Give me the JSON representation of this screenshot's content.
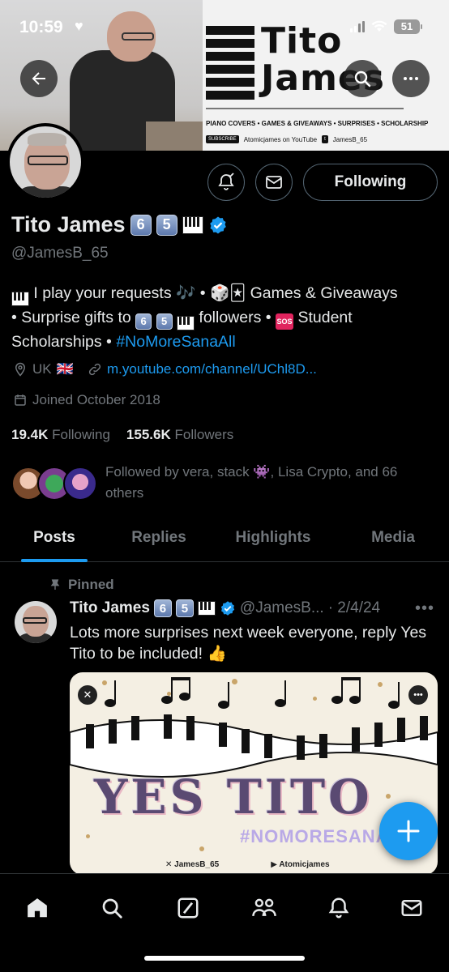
{
  "status_bar": {
    "time": "10:59",
    "battery": "51"
  },
  "banner": {
    "logo_line1": "Tito",
    "logo_line2": "James",
    "tagline": "PIANO COVERS • GAMES & GIVEAWAYS • SURPRISES • SCHOLARSHIP",
    "subscribe_badge": "SUBSCRIBE",
    "youtube_text": "Atomicjames on YouTube",
    "twitter_text": "JamesB_65"
  },
  "profile": {
    "display_name": "Tito James",
    "badge_digits": [
      "6",
      "5"
    ],
    "handle": "@JamesB_65",
    "bio_part1": "I play your requests",
    "bio_part2": "Games & Giveaways",
    "bio_part3": "• Surprise gifts to",
    "bio_part4": "followers •",
    "bio_part5": "Student Scholarships •",
    "bio_hashtag": "#NoMoreSanaAll",
    "sos_label": "SOS",
    "location": "UK",
    "location_flag": "🇬🇧",
    "website": "m.youtube.com/channel/UChl8D...",
    "joined": "Joined October 2018",
    "following_count": "19.4K",
    "following_label": "Following",
    "followers_count": "155.6K",
    "followers_label": "Followers",
    "followed_by": "Followed by vera, stack 👾, Lisa Crypto, and 66 others"
  },
  "actions": {
    "following_button": "Following"
  },
  "tabs": [
    {
      "label": "Posts",
      "active": true
    },
    {
      "label": "Replies",
      "active": false
    },
    {
      "label": "Highlights",
      "active": false
    },
    {
      "label": "Media",
      "active": false
    }
  ],
  "post": {
    "pinned_label": "Pinned",
    "author_name": "Tito James",
    "author_handle": "@JamesB...",
    "date": "· 2/4/24",
    "text": "Lots more surprises next week everyone, reply Yes Tito to be included! 👍",
    "media": {
      "headline": "YES TITO",
      "hashtag": "#NOMORESANA",
      "footer_x": "JamesB_65",
      "footer_yt": "Atomicjames"
    }
  },
  "colors": {
    "accent": "#1d9bf0",
    "background": "#000000",
    "muted": "#71767b",
    "text": "#e7e9ea"
  },
  "icons": {
    "nav": [
      "home-icon",
      "search-icon",
      "grok-icon",
      "communities-icon",
      "notifications-icon",
      "messages-icon"
    ]
  }
}
